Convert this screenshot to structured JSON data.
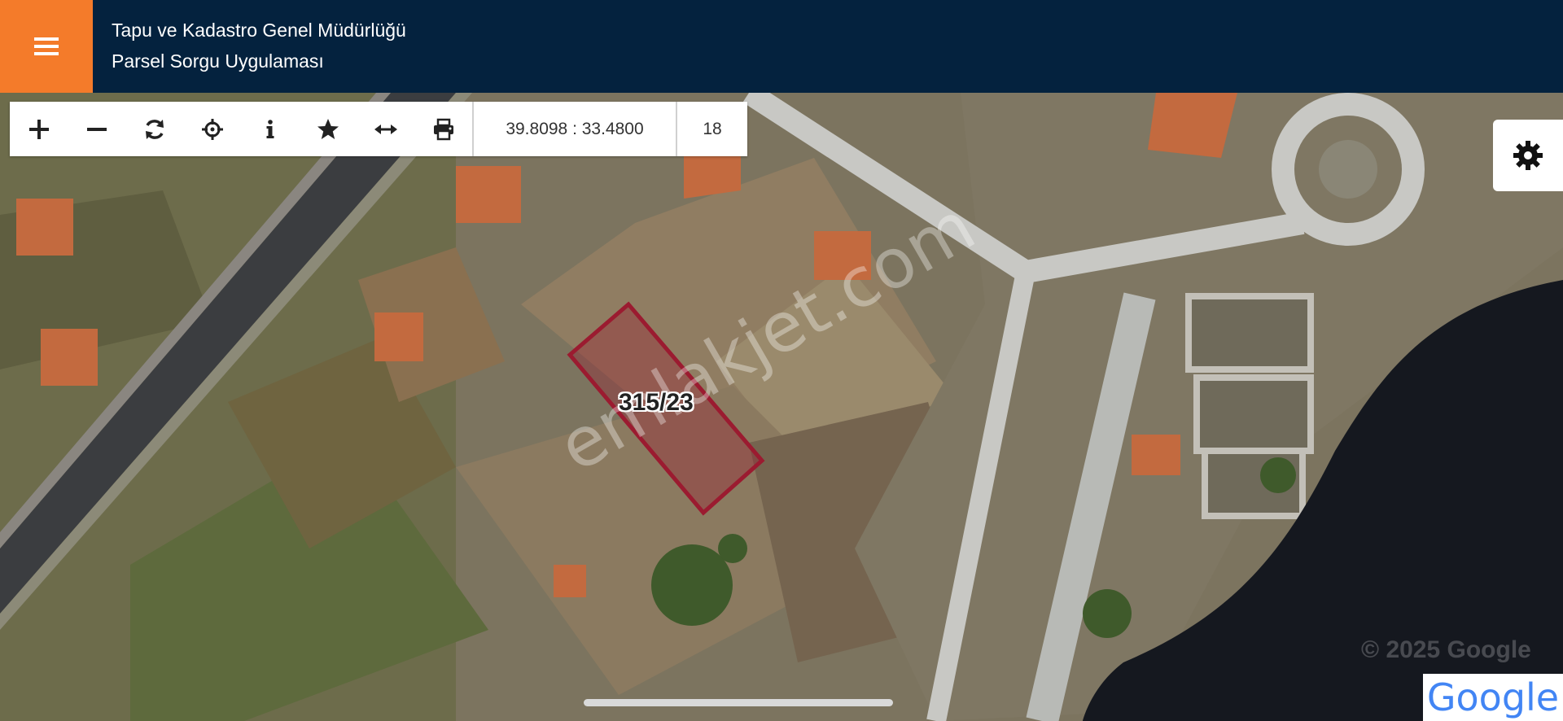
{
  "header": {
    "title_line1": "Tapu ve Kadastro Genel Müdürlüğü",
    "title_line2": "Parsel Sorgu Uygulaması",
    "menu_icon": "hamburger-menu-icon",
    "accent_color": "#f47b2a",
    "bar_color": "#04223e"
  },
  "toolbar": {
    "tools": [
      {
        "name": "zoom-in",
        "icon": "plus-icon"
      },
      {
        "name": "zoom-out",
        "icon": "minus-icon"
      },
      {
        "name": "refresh",
        "icon": "refresh-icon"
      },
      {
        "name": "locate",
        "icon": "crosshair-icon"
      },
      {
        "name": "info",
        "icon": "info-icon"
      },
      {
        "name": "favorite",
        "icon": "star-icon"
      },
      {
        "name": "measure",
        "icon": "arrows-horizontal-icon"
      },
      {
        "name": "print",
        "icon": "printer-icon"
      }
    ],
    "coordinates": "39.8098 : 33.4800",
    "zoom_level": "18"
  },
  "map": {
    "parcel_label": "315/23",
    "parcel_outline_color": "#9b1b30",
    "watermark": "emlakjet.com",
    "copyright": "© 2025 Google",
    "provider_logo": "Google"
  },
  "settings": {
    "icon": "gear-icon"
  }
}
